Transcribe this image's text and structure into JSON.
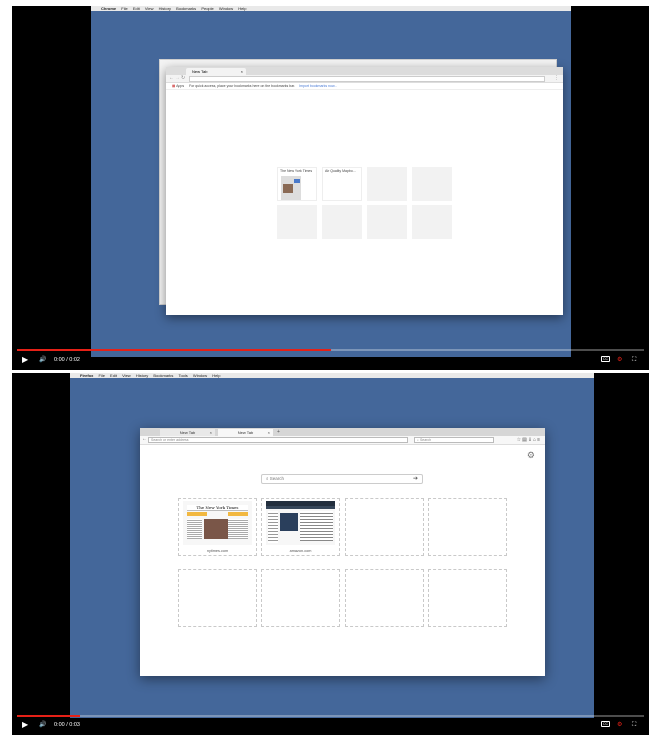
{
  "top_frame": {
    "menubar": [
      "Chrome",
      "File",
      "Edit",
      "View",
      "History",
      "Bookmarks",
      "People",
      "Window",
      "Help"
    ],
    "tab_title": "New Tab",
    "bookmarks_apps": "Apps",
    "bookmarks_text": "For quick access, place your bookmarks here on the bookmarks bar.",
    "bookmarks_link": "Import bookmarks now...",
    "tiles": [
      {
        "label": "The New York Times"
      },
      {
        "label": "Air Quality Mapbo..."
      }
    ],
    "time": "0:00 / 0:02",
    "progress": 0.5
  },
  "bottom_frame": {
    "menubar": [
      "Firefox",
      "File",
      "Edit",
      "View",
      "History",
      "Bookmarks",
      "Tools",
      "Window",
      "Help"
    ],
    "tabs": [
      {
        "label": "New Tab"
      },
      {
        "label": "New Tab"
      }
    ],
    "url_placeholder": "Search or enter address",
    "search_placeholder": "Search",
    "newtab_search_placeholder": "Search",
    "tiles": [
      {
        "name": "nytimes.com"
      },
      {
        "name": "amazon.com"
      }
    ],
    "nyt_masthead": "The New York Times",
    "time": "0:00 / 0:03",
    "progress": 0.1
  },
  "colors": {
    "desktop": "#44679a",
    "progress": "#e62117"
  }
}
